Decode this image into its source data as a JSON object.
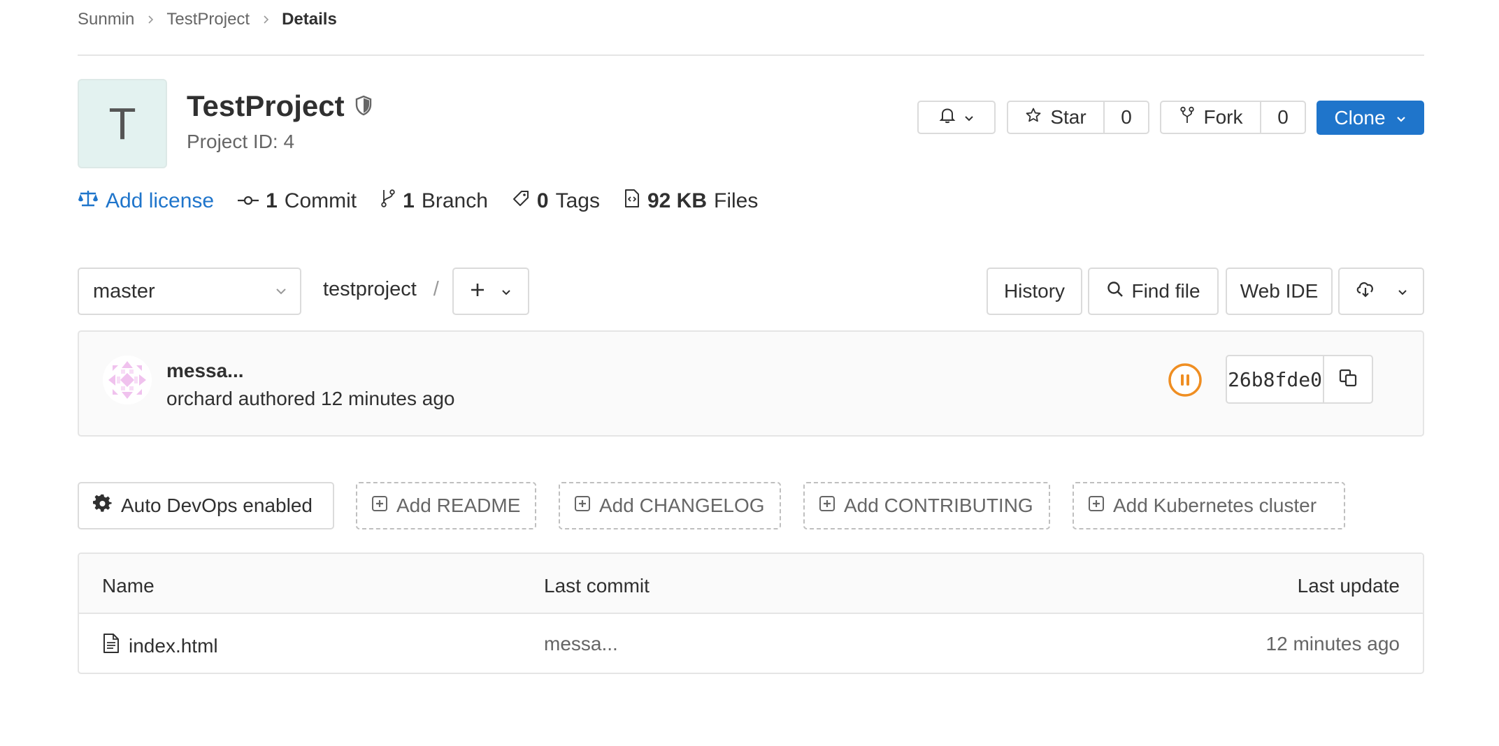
{
  "breadcrumb": {
    "items": [
      "Sunmin",
      "TestProject"
    ],
    "current": "Details"
  },
  "project": {
    "avatar_letter": "T",
    "title": "TestProject",
    "id_text": "Project ID: 4",
    "visibility_icon": "shield-icon"
  },
  "actions": {
    "star_label": "Star",
    "star_count": "0",
    "fork_label": "Fork",
    "fork_count": "0",
    "clone_label": "Clone"
  },
  "stats": {
    "license_label": "Add license",
    "commits_count": "1",
    "commits_label": "Commit",
    "branches_count": "1",
    "branches_label": "Branch",
    "tags_count": "0",
    "tags_label": "Tags",
    "files_size": "92 KB",
    "files_label": "Files"
  },
  "tree": {
    "branch": "master",
    "path": "testproject",
    "path_sep": "/",
    "history_label": "History",
    "find_file_label": "Find file",
    "web_ide_label": "Web IDE"
  },
  "commit": {
    "title": "messa...",
    "meta": "orchard authored 12 minutes ago",
    "sha": "26b8fde0",
    "pipeline_status": "paused"
  },
  "quick_actions": {
    "auto_devops": "Auto DevOps enabled",
    "add_readme": "Add README",
    "add_changelog": "Add CHANGELOG",
    "add_contributing": "Add CONTRIBUTING",
    "add_k8s": "Add Kubernetes cluster"
  },
  "files": {
    "columns": [
      "Name",
      "Last commit",
      "Last update"
    ],
    "rows": [
      {
        "name": "index.html",
        "last_commit": "messa...",
        "last_update": "12 minutes ago"
      }
    ]
  },
  "colors": {
    "primary": "#1f75cb",
    "pipeline_paused": "#ef8e22",
    "avatar_bg": "#e3f2f0"
  }
}
